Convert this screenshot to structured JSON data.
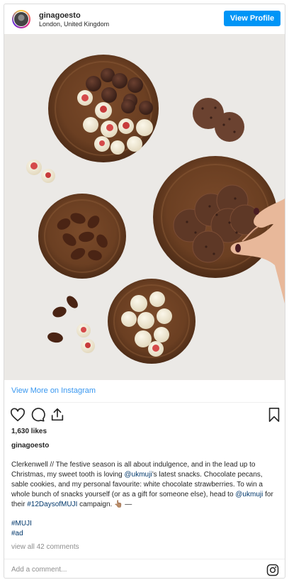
{
  "header": {
    "username": "ginagoesto",
    "location": "London, United Kingdom",
    "view_profile_label": "View Profile"
  },
  "image": {
    "alt": "Wooden bowls of chocolate-covered strawberries, pecans and cookies"
  },
  "view_more_label": "View More on Instagram",
  "actions": {
    "icons": [
      "heart-icon",
      "comment-icon",
      "share-icon",
      "bookmark-icon"
    ]
  },
  "likes_text": "1,630 likes",
  "poster_username": "ginagoesto",
  "caption": {
    "part1": "Clerkenwell // The festive season is all about indulgence, and in the lead up to Christmas, my sweet tooth is loving ",
    "mention1": "@ukmuji",
    "part2": "’s latest snacks. Chocolate pecans, sable cookies, and my personal favourite: white chocolate strawberries. To win a whole bunch of snacks yourself (or as a gift for someone else), head to ",
    "mention2": "@ukmuji",
    "part3": " for their ",
    "hashtag": "#12DaysofMUJI",
    "part4": " campaign. 👆🏽 —"
  },
  "hashtags": [
    "#MUJI",
    "#ad"
  ],
  "comments_link": "view all 42 comments",
  "comment_placeholder": "Add a comment...",
  "colors": {
    "button_blue": "#0095f6",
    "link_blue": "#3897f0",
    "hashtag_blue": "#00376b",
    "muted_gray": "#8e8e8e"
  }
}
